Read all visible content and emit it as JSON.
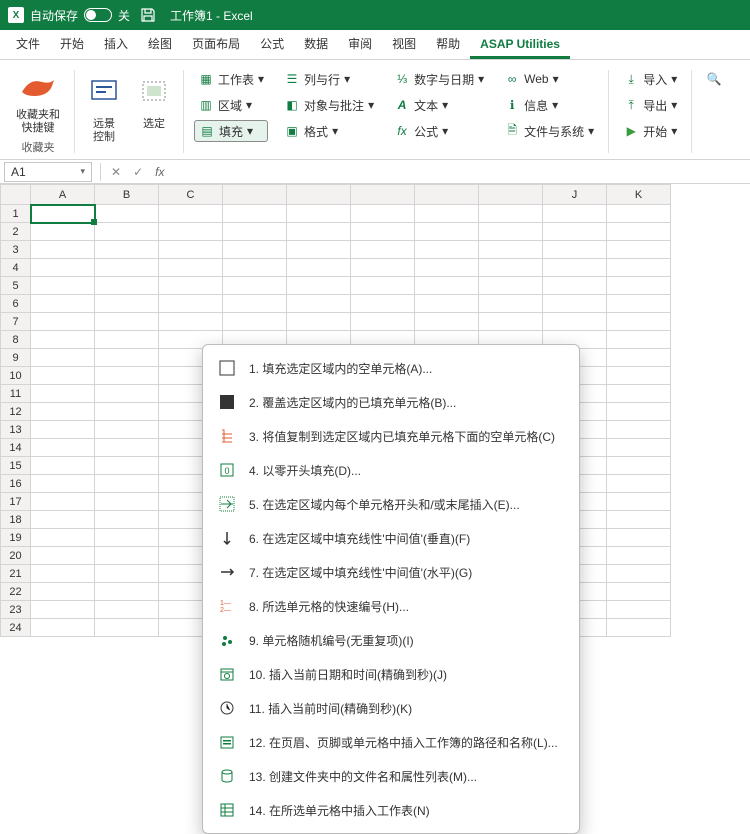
{
  "titlebar": {
    "autosave_label": "自动保存",
    "autosave_state": "关",
    "doc_title": "工作簿1  -  Excel"
  },
  "tabs": [
    "文件",
    "开始",
    "插入",
    "绘图",
    "页面布局",
    "公式",
    "数据",
    "审阅",
    "视图",
    "帮助",
    "ASAP Utilities"
  ],
  "active_tab_index": 10,
  "ribbon": {
    "group1_label": "收藏夹和\n快捷键",
    "group1_caption": "收藏夹",
    "group2_label": "远景\n控制",
    "group3_label": "选定",
    "col1": {
      "worksheet": "工作表",
      "region": "区域",
      "fill": "填充"
    },
    "col2": {
      "colrow": "列与行",
      "objcomment": "对象与批注",
      "format": "格式"
    },
    "col3": {
      "numdate": "数字与日期",
      "text": "文本",
      "formula": "公式"
    },
    "col4": {
      "web": "Web",
      "info": "信息",
      "filesys": "文件与系统"
    },
    "col5": {
      "import": "导入",
      "export": "导出",
      "start": "开始"
    }
  },
  "namebox": "A1",
  "columns": [
    "A",
    "B",
    "C",
    "",
    "",
    "",
    "",
    "",
    "J",
    "K"
  ],
  "rows": [
    "1",
    "2",
    "3",
    "4",
    "5",
    "6",
    "7",
    "8",
    "9",
    "10",
    "11",
    "12",
    "13",
    "14",
    "15",
    "16",
    "17",
    "18",
    "19",
    "20",
    "21",
    "22",
    "23",
    "24"
  ],
  "menu": [
    {
      "n": "1.",
      "t": "填充选定区域内的空单元格(A)..."
    },
    {
      "n": "2.",
      "t": "覆盖选定区域内的已填充单元格(B)..."
    },
    {
      "n": "3.",
      "t": "将值复制到选定区域内已填充单元格下面的空单元格(C)"
    },
    {
      "n": "4.",
      "t": "以零开头填充(D)..."
    },
    {
      "n": "5.",
      "t": "在选定区域内每个单元格开头和/或末尾插入(E)..."
    },
    {
      "n": "6.",
      "t": "在选定区域中填充线性'中间值'(垂直)(F)"
    },
    {
      "n": "7.",
      "t": "在选定区域中填充线性'中间值'(水平)(G)"
    },
    {
      "n": "8.",
      "t": "所选单元格的快速编号(H)..."
    },
    {
      "n": "9.",
      "t": "单元格随机编号(无重复项)(I)"
    },
    {
      "n": "10.",
      "t": "插入当前日期和时间(精确到秒)(J)"
    },
    {
      "n": "11.",
      "t": "插入当前时间(精确到秒)(K)"
    },
    {
      "n": "12.",
      "t": "在页眉、页脚或单元格中插入工作簿的路径和名称(L)..."
    },
    {
      "n": "13.",
      "t": "创建文件夹中的文件名和属性列表(M)..."
    },
    {
      "n": "14.",
      "t": "在所选单元格中插入工作表(N)"
    }
  ]
}
